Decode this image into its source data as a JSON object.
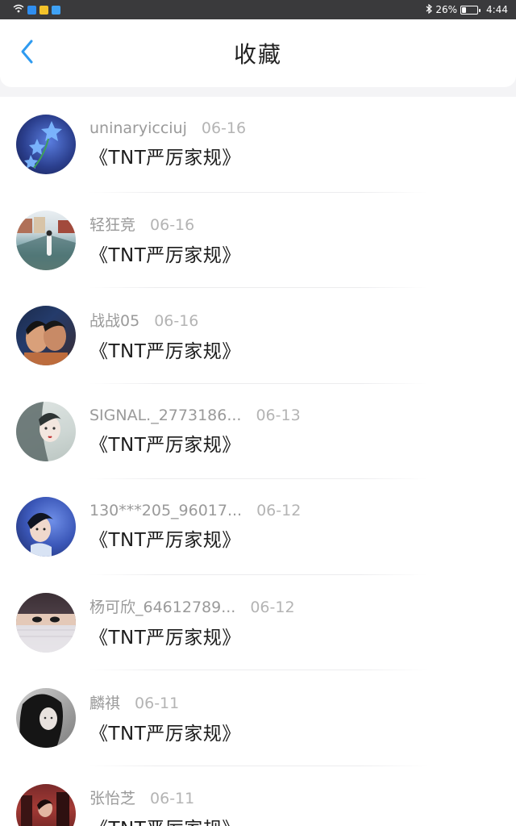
{
  "status_bar": {
    "battery": "26%",
    "battery_level": 0.26,
    "time": "4:44",
    "left_icons": [
      "wifi-icon",
      "app-shield-icon",
      "app-paw-icon",
      "app-cloud-icon"
    ],
    "right_icons": [
      "bluetooth-icon",
      "battery-icon"
    ]
  },
  "header": {
    "title": "收藏",
    "back_icon": "chevron-left-icon",
    "accent_color": "#2f9bf0"
  },
  "favorites": [
    {
      "username": "uninaryicciuj",
      "date": "06-16",
      "title": "《TNT严厉家规》",
      "avatar": "blue-flowers"
    },
    {
      "username": "轻狂竞",
      "date": "06-16",
      "title": "《TNT严厉家规》",
      "avatar": "street-scene"
    },
    {
      "username": "战战05",
      "date": "06-16",
      "title": "《TNT严厉家规》",
      "avatar": "two-men"
    },
    {
      "username": "SIGNAL._2773186...",
      "date": "06-13",
      "title": "《TNT严厉家规》",
      "avatar": "illustrated-girl"
    },
    {
      "username": "130***205_96017...",
      "date": "06-12",
      "title": "《TNT严厉家规》",
      "avatar": "young-man-blue"
    },
    {
      "username": "杨可欣_64612789...",
      "date": "06-12",
      "title": "《TNT严厉家规》",
      "avatar": "masked-face"
    },
    {
      "username": "麟祺",
      "date": "06-11",
      "title": "《TNT严厉家规》",
      "avatar": "dark-haired-woman"
    },
    {
      "username": "张怡芝",
      "date": "06-11",
      "title": "《TNT严厉家规》",
      "avatar": "red-scene"
    }
  ]
}
